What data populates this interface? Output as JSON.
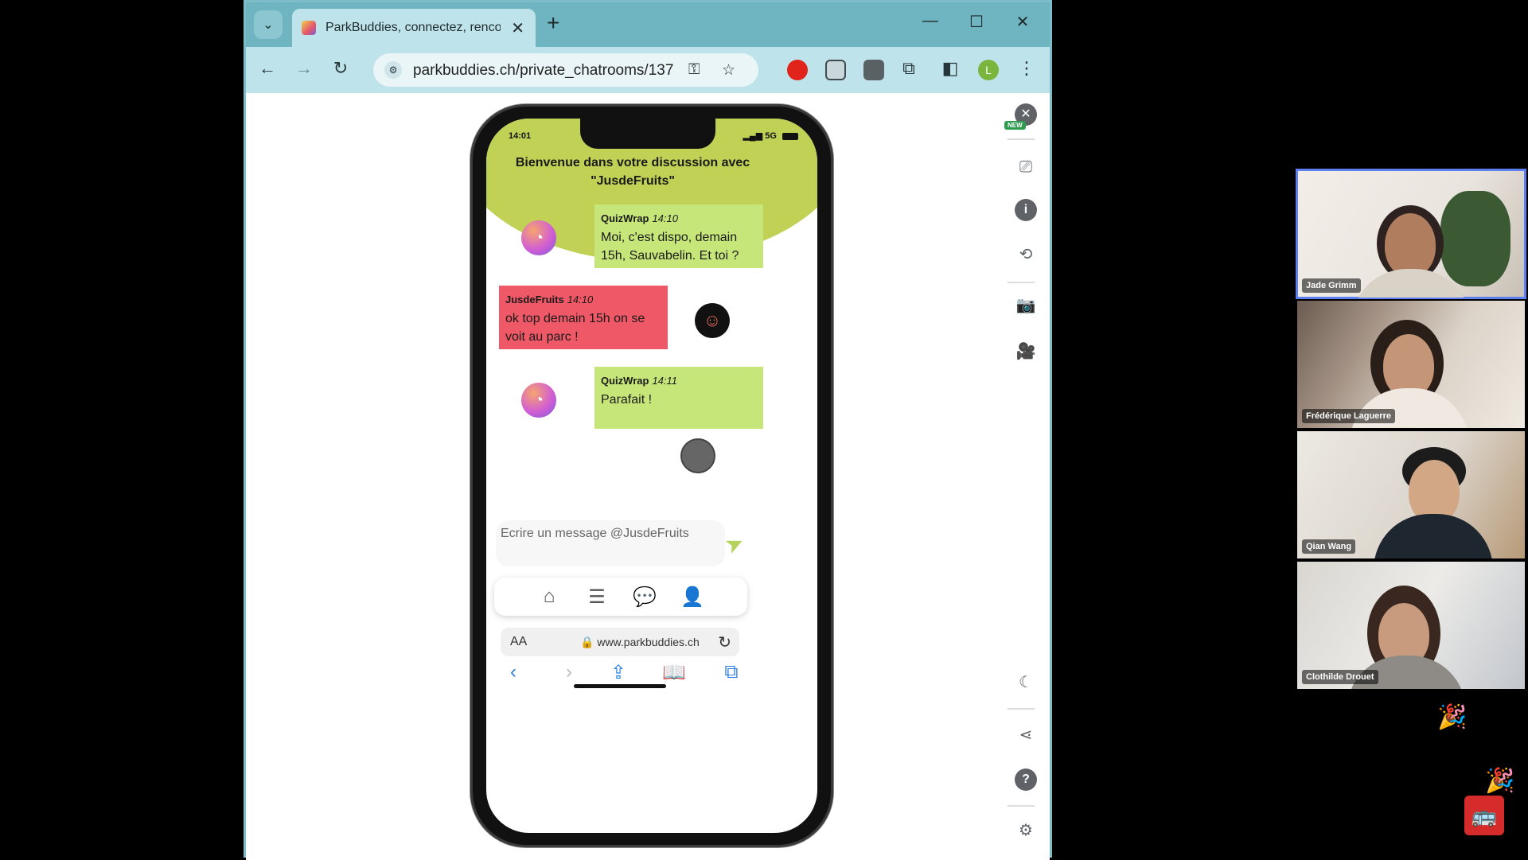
{
  "browser": {
    "tab_title": "ParkBuddies, connectez, rencon",
    "url": "parkbuddies.ch/private_chatrooms/137",
    "profile_initial": "L"
  },
  "phone": {
    "status_time": "14:01",
    "status_network": "5G",
    "welcome_text": "Bienvenue dans votre discussion avec \"JusdeFruits\"",
    "messages": [
      {
        "author": "QuizWrap",
        "time": "14:10",
        "text": "Moi, c'est dispo, demain 15h, Sauvabelin. Et toi ?"
      },
      {
        "author": "JusdeFruits",
        "time": "14:10",
        "text": "ok top demain 15h on se voit au parc !"
      },
      {
        "author": "QuizWrap",
        "time": "14:11",
        "text": "Parafait !"
      }
    ],
    "input_placeholder": "Ecrire un message @JusdeFruits",
    "safari_text_size": "AA",
    "safari_url": "www.parkbuddies.ch"
  },
  "sidebar": {
    "new_badge": "NEW"
  },
  "participants": [
    {
      "name": "Jade Grimm"
    },
    {
      "name": "Frédérique Laguerre"
    },
    {
      "name": "Qian Wang"
    },
    {
      "name": "Clothilde Drouet"
    }
  ],
  "colors": {
    "tab_bar": "#6fb5c1",
    "toolbar": "#bfe3ea",
    "welcome_bg": "#c0d155",
    "msg_green": "#c7e67a",
    "msg_red": "#ef5866",
    "active_speaker": "#5d7ff2"
  }
}
